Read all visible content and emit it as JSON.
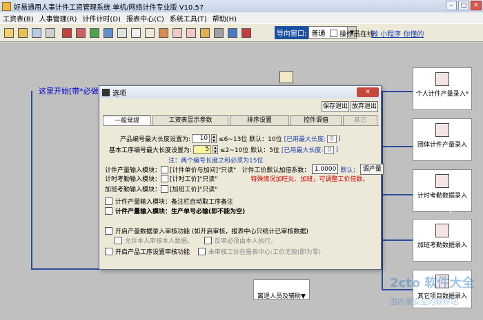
{
  "window": {
    "title": "好易通用人事计件工资管理系统 单机/网络计件专业版 V10.57",
    "min": "–",
    "max": "□",
    "close": "✕"
  },
  "menu": [
    "工资表(B)",
    "人事管理(R)",
    "计件计时(D)",
    "报表中心(C)",
    "系统工具(T)",
    "帮助(H)"
  ],
  "toolbar": {
    "buttons": [
      "open-icon",
      "folder-icon",
      "report-icon",
      "grid-icon",
      "user-icon",
      "user-edit-icon",
      "group-icon",
      "calendar-icon",
      "clock-icon",
      "doc-icon",
      "doc2-icon",
      "stamp-icon",
      "edit-icon",
      "edit2-icon",
      "money-icon",
      "settings-icon",
      "export-icon",
      "exit-icon"
    ],
    "nav_label": "导向窗口:",
    "nav_value": "普通",
    "online_label": "操作员在线",
    "wechat_link": "微 小程序 你懂的"
  },
  "canvas": {
    "start_text": "这里开始[带*必做",
    "side_buttons": [
      "个人计件产量录入*",
      "团体计件产量录入",
      "计时考勤数据录入",
      "加班考勤数据录入",
      "其它项目数据录入"
    ],
    "mid_button": "离退人员及辅助▼",
    "watermark": "2cto 软件大全",
    "watermark2": "国内最安全的软件站"
  },
  "dialog": {
    "title": "选项",
    "close": "✕",
    "save_exit": "保存退出",
    "cancel_exit": "放弃退出",
    "tabs": [
      "一般常规",
      "工资表显示参数",
      "排序设置",
      "控件调值",
      "其它"
    ],
    "product_len_label": "产品编号最大长度设置为:",
    "product_len_value": "10",
    "product_len_hint": "≤6~13位  默认：10位",
    "used_max_label": "[已用最大长度:",
    "product_used_value": "0",
    "process_len_label": "基本工序编号最大长度设置为:",
    "process_len_value": "5",
    "process_len_hint": "≤2~10位  默认：5位",
    "process_used_value": "0",
    "note": "注：两个编号长度之和必须为15位",
    "piece_input_label": "计件产量输入模块：",
    "piece_input_opt": "[计件单价与加间]\"只读\"",
    "piece_factor_label": "计件工价默认加倍系数：",
    "piece_factor_value": "1.0000",
    "default_label": "默认：",
    "adjust_button": "调产量",
    "timing_input_label": "计时考勤输入模块：",
    "timing_input_opt": "[计时工价]\"只读\"",
    "special_note": "特殊情况加旺炎、加班，可调整工价倍数。",
    "overtime_input_label": "加班考勤输入模块：",
    "overtime_input_opt": "[加班工价]\"只读\"",
    "auto_fill_label": "计件产量输入模块：备注栏自动取工序备注",
    "required_label": "计件产量输入模块：生产单号必输(即不能为空)",
    "audit_label": "开启产量数据录入审核功能 (如开启审核，报表中心只统计已审核数据)",
    "audit_self_label": "允许本人审核本人数据。",
    "audit_reverse_label": "反审必须由本人执行。",
    "process_audit_label": "开启产品工序设置审核功能",
    "unaudited_label": "未审核工价在报表中心:工价无效(即为零)"
  }
}
